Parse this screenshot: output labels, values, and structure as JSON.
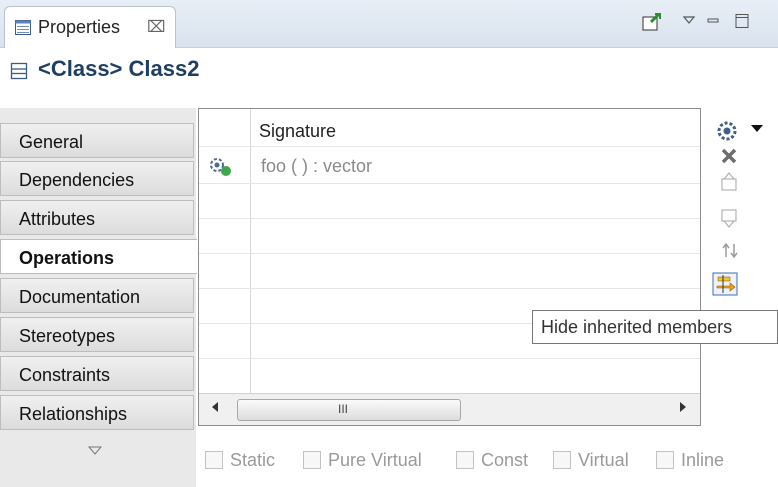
{
  "view": {
    "tab_label": "Properties",
    "tab_close_glyph": "⌧"
  },
  "header": {
    "title": "<Class> Class2",
    "icon": "class-icon"
  },
  "categories": [
    {
      "label": "General",
      "selected": false
    },
    {
      "label": "Dependencies",
      "selected": false
    },
    {
      "label": "Attributes",
      "selected": false
    },
    {
      "label": "Operations",
      "selected": true
    },
    {
      "label": "Documentation",
      "selected": false
    },
    {
      "label": "Stereotypes",
      "selected": false
    },
    {
      "label": "Constraints",
      "selected": false
    },
    {
      "label": "Relationships",
      "selected": false
    }
  ],
  "table": {
    "column_header": "Signature",
    "rows": [
      {
        "signature": "foo ( ) : vector",
        "icon": "operation-icon"
      }
    ],
    "scrollbar_grip": "III"
  },
  "tooltip": "Hide inherited members",
  "modifiers": [
    "Static",
    "Pure Virtual",
    "Const",
    "Virtual",
    "Inline"
  ],
  "colors": {
    "title": "#1f3e63",
    "tabbar": "#dae3ee",
    "disabled_text": "#9a9a9a"
  }
}
